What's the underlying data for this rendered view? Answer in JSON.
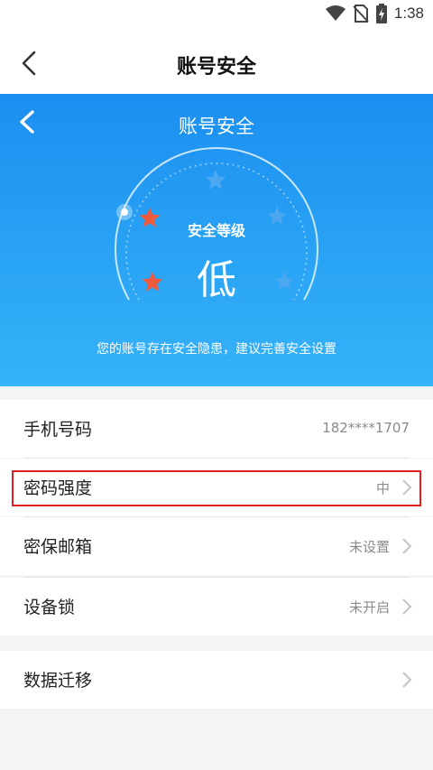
{
  "status_bar": {
    "time": "1:38"
  },
  "navbar": {
    "title": "账号安全"
  },
  "hero": {
    "title": "账号安全",
    "level_label": "安全等级",
    "level_value": "低",
    "stars_filled": 2,
    "stars_total": 5,
    "tip": "您的账号存在安全隐患，建议完善安全设置"
  },
  "settings": {
    "phone": {
      "label": "手机号码",
      "value": "182****1707"
    },
    "password": {
      "label": "密码强度",
      "value": "中"
    },
    "email": {
      "label": "密保邮箱",
      "value": "未设置"
    },
    "device_lock": {
      "label": "设备锁",
      "value": "未开启"
    },
    "migrate": {
      "label": "数据迁移"
    }
  },
  "colors": {
    "hero_top": "#1b8ff0",
    "hero_bottom": "#35b3f8",
    "star_filled": "#f05a3c",
    "star_empty": "#4aa7f0",
    "highlight": "#e02020"
  }
}
